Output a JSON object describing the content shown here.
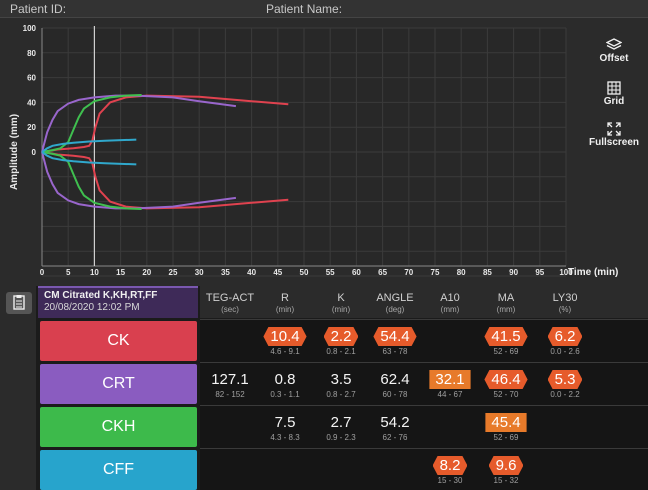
{
  "header": {
    "patient_id_label": "Patient ID:",
    "patient_name_label": "Patient Name:"
  },
  "side_tools": [
    {
      "label": "Offset",
      "icon": "layers-icon"
    },
    {
      "label": "Grid",
      "icon": "grid-icon"
    },
    {
      "label": "Fullscreen",
      "icon": "expand-icon"
    }
  ],
  "chart_data": {
    "type": "line",
    "ylabel": "Amplitude (mm)",
    "xlabel": "Time (min)",
    "xlim": [
      0,
      100
    ],
    "ylim": [
      -100,
      100
    ],
    "x_ticks": [
      "0",
      "5",
      "10",
      "15",
      "20",
      "25",
      "30",
      "35",
      "40",
      "45",
      "50",
      "55",
      "60",
      "65",
      "70",
      "75",
      "80",
      "85",
      "90",
      "95",
      "100"
    ],
    "y_ticks": [
      "100",
      "80",
      "60",
      "40",
      "20",
      "0"
    ],
    "cursor_x": 10,
    "series": [
      {
        "color": "#e0424f",
        "x": [
          0,
          3,
          6,
          8,
          9,
          9.6,
          10.2,
          11,
          13,
          16,
          20,
          30,
          40,
          47
        ],
        "y": [
          0,
          2,
          3,
          4,
          5,
          9,
          20,
          31,
          40,
          44,
          45.5,
          44.5,
          41,
          38.5
        ]
      },
      {
        "color": "#9966cc",
        "x": [
          0,
          1,
          2,
          3,
          5,
          7,
          10,
          14,
          18,
          25,
          30,
          37
        ],
        "y": [
          0,
          16,
          26,
          33,
          39,
          42,
          44,
          45.5,
          45.5,
          44,
          41,
          37
        ]
      },
      {
        "color": "#3fbf4f",
        "x": [
          0,
          2,
          3.5,
          5,
          6,
          7,
          8,
          10,
          13,
          16,
          19
        ],
        "y": [
          0,
          1.5,
          3,
          8,
          18,
          28,
          35,
          41,
          44,
          45.5,
          46
        ]
      },
      {
        "color": "#30a8cc",
        "x": [
          0,
          1,
          2,
          4,
          6,
          9,
          12,
          18
        ],
        "y": [
          0,
          3,
          5,
          6.5,
          7.5,
          8.5,
          9,
          10
        ]
      },
      {
        "color": "#30a8cc",
        "x": [
          0,
          1,
          2,
          4,
          6,
          9,
          12,
          18
        ],
        "y": [
          0,
          -3,
          -5,
          -6.5,
          -7.5,
          -8.5,
          -9,
          -10
        ]
      }
    ]
  },
  "sample": {
    "title": "CM Citrated K,KH,RT,FF",
    "datetime": "20/08/2020 12:02 PM"
  },
  "columns": [
    {
      "name": "TEG-ACT",
      "unit": "(sec)"
    },
    {
      "name": "R",
      "unit": "(min)"
    },
    {
      "name": "K",
      "unit": "(min)"
    },
    {
      "name": "ANGLE",
      "unit": "(deg)"
    },
    {
      "name": "A10",
      "unit": "(mm)"
    },
    {
      "name": "MA",
      "unit": "(mm)"
    },
    {
      "name": "LY30",
      "unit": "(%)"
    }
  ],
  "rows": [
    {
      "label": "CK",
      "color": "#d9404f",
      "cells": [
        null,
        {
          "value": "10.4",
          "range": "4.6 - 9.1",
          "flag": "bad"
        },
        {
          "value": "2.2",
          "range": "0.8 - 2.1",
          "flag": "bad"
        },
        {
          "value": "54.4",
          "range": "63 - 78",
          "flag": "bad"
        },
        null,
        {
          "value": "41.5",
          "range": "52 - 69",
          "flag": "bad"
        },
        {
          "value": "6.2",
          "range": "0.0 - 2.6",
          "flag": "bad"
        }
      ]
    },
    {
      "label": "CRT",
      "color": "#8a5cc0",
      "cells": [
        {
          "value": "127.1",
          "range": "82 - 152",
          "flag": ""
        },
        {
          "value": "0.8",
          "range": "0.3 - 1.1",
          "flag": ""
        },
        {
          "value": "3.5",
          "range": "0.8 - 2.7",
          "flag": ""
        },
        {
          "value": "62.4",
          "range": "60 - 78",
          "flag": ""
        },
        {
          "value": "32.1",
          "range": "44 - 67",
          "flag": "warn"
        },
        {
          "value": "46.4",
          "range": "52 - 70",
          "flag": "bad"
        },
        {
          "value": "5.3",
          "range": "0.0 - 2.2",
          "flag": "bad"
        }
      ]
    },
    {
      "label": "CKH",
      "color": "#3dba4b",
      "cells": [
        null,
        {
          "value": "7.5",
          "range": "4.3 - 8.3",
          "flag": ""
        },
        {
          "value": "2.7",
          "range": "0.9 - 2.3",
          "flag": ""
        },
        {
          "value": "54.2",
          "range": "62 - 76",
          "flag": ""
        },
        null,
        {
          "value": "45.4",
          "range": "52 - 69",
          "flag": "warn"
        },
        null
      ]
    },
    {
      "label": "CFF",
      "color": "#27a4cc",
      "cells": [
        null,
        null,
        null,
        null,
        {
          "value": "8.2",
          "range": "15 - 30",
          "flag": "bad"
        },
        {
          "value": "9.6",
          "range": "15 - 32",
          "flag": "bad"
        },
        null
      ]
    }
  ]
}
